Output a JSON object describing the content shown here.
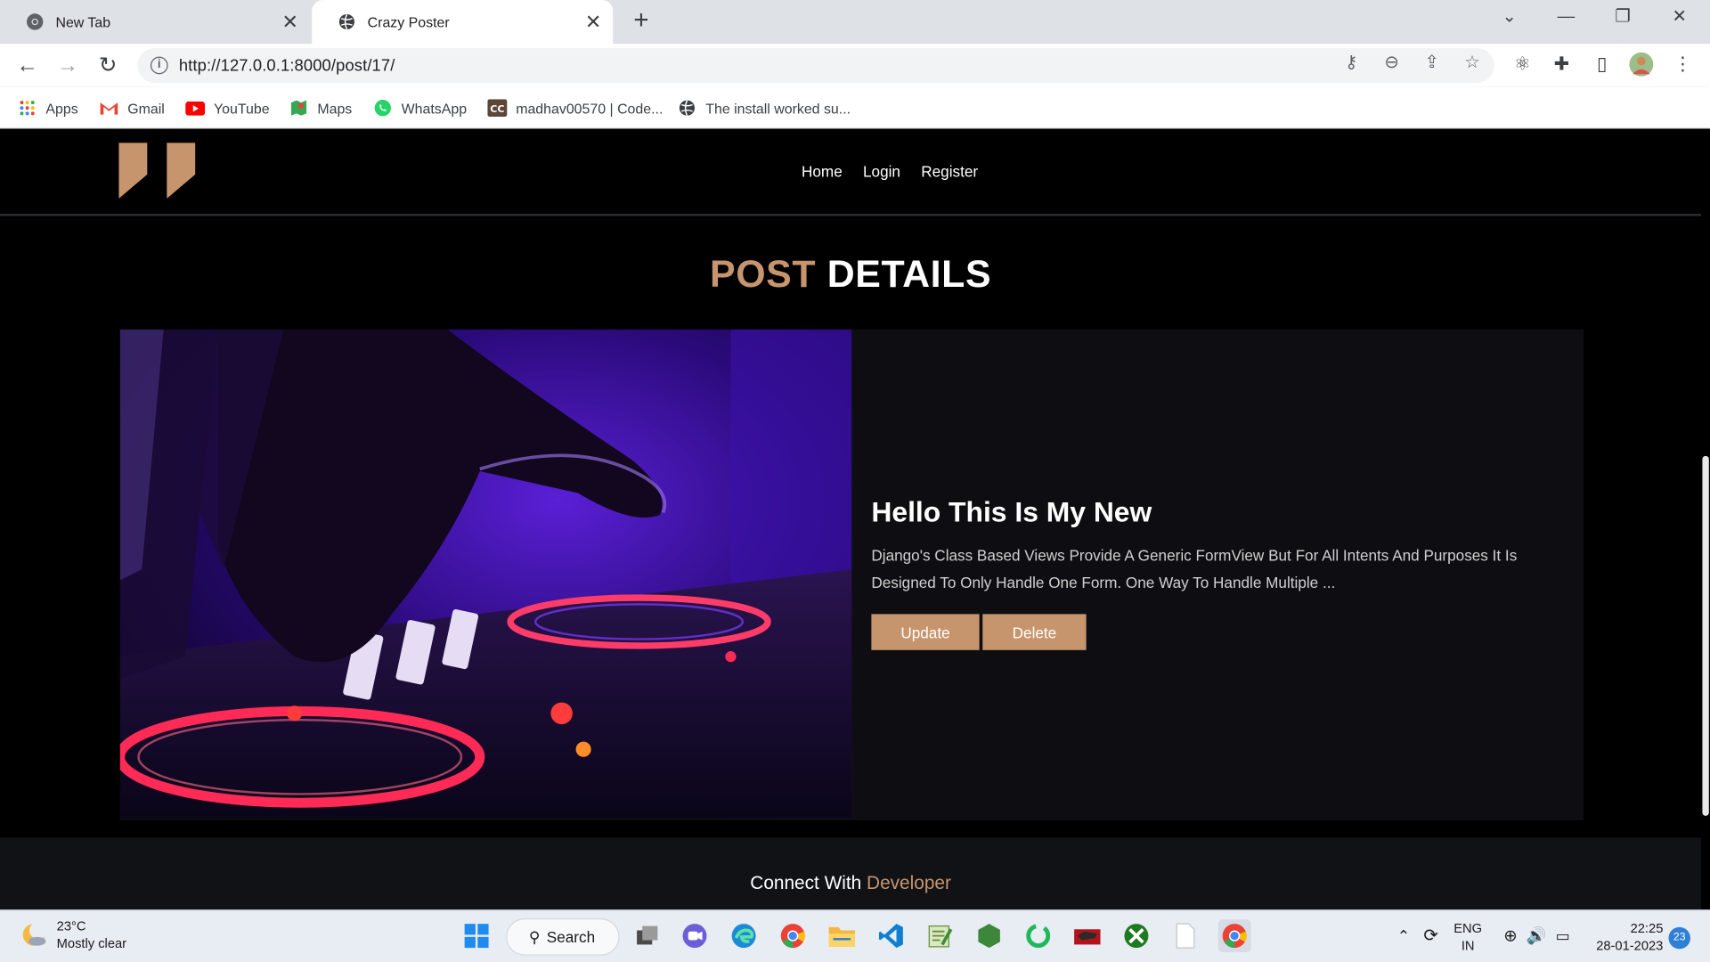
{
  "browser": {
    "tabs": [
      {
        "title": "New Tab",
        "active": false
      },
      {
        "title": "Crazy Poster",
        "active": true
      }
    ],
    "url": "http://127.0.0.1:8000/post/17/",
    "bookmarks": [
      "Apps",
      "Gmail",
      "YouTube",
      "Maps",
      "WhatsApp",
      "madhav00570 | Code...",
      "The install worked su..."
    ]
  },
  "site": {
    "nav": [
      "Home",
      "Login",
      "Register"
    ],
    "section_title": {
      "accent": "POST",
      "rest": "DETAILS"
    },
    "post": {
      "title": "Hello This Is My New",
      "description": "Django's Class Based Views Provide A Generic FormView But For All Intents And Purposes It Is Designed To Only Handle One Form. One Way To Handle Multiple ...",
      "update_label": "Update",
      "delete_label": "Delete",
      "image_alt": "DJ turntable with neon purple lighting"
    },
    "footer": {
      "text": "Connect With",
      "accent": "Developer"
    }
  },
  "taskbar": {
    "weather_temp": "23°C",
    "weather_desc": "Mostly clear",
    "search_label": "Search",
    "lang_line1": "ENG",
    "lang_line2": "IN",
    "time": "22:25",
    "date": "28-01-2023",
    "notifications": "23"
  },
  "colors": {
    "accent": "#c7956d",
    "page_bg": "#000000",
    "card_bg": "#0e0e12"
  }
}
